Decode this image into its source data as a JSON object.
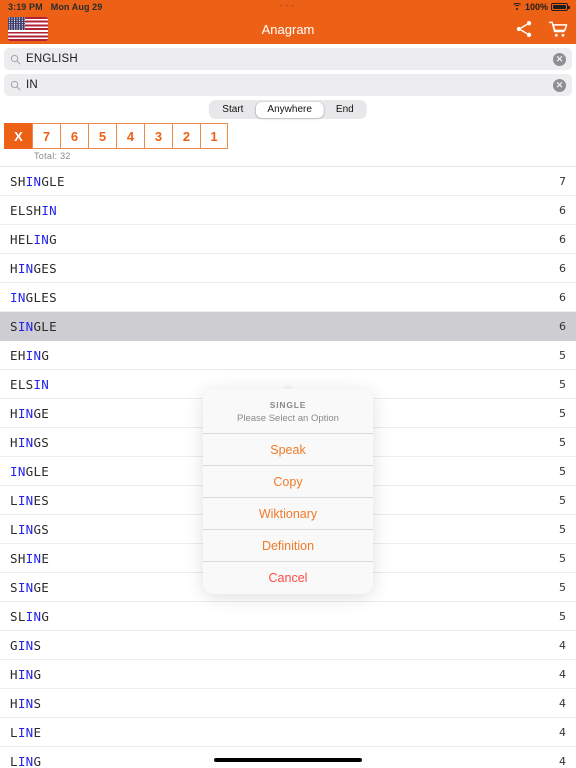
{
  "status_bar": {
    "time": "3:19 PM",
    "date": "Mon Aug 29",
    "center_dots": "•••",
    "battery_percent": "100%",
    "wifi_icon": "wifi-icon",
    "battery_icon": "battery-full-icon"
  },
  "nav_bar": {
    "title": "Anagram",
    "flag_icon": "us-flag-icon",
    "share_icon": "share-icon",
    "cart_icon": "shopping-cart-icon",
    "background_color": "#EC6116"
  },
  "search": {
    "fields": [
      {
        "value": "ENGLISH",
        "placeholder": "Search",
        "icon": "search-icon",
        "clear_icon": "clear-circle-icon"
      },
      {
        "value": "IN",
        "placeholder": "Search",
        "icon": "search-icon",
        "clear_icon": "clear-circle-icon"
      }
    ]
  },
  "match_mode": {
    "options": [
      "Start",
      "Anywhere",
      "End"
    ],
    "selected": "Anywhere"
  },
  "length_filter": {
    "buttons": [
      "X",
      "7",
      "6",
      "5",
      "4",
      "3",
      "2",
      "1"
    ],
    "active": "X",
    "accent_color": "#EC6116"
  },
  "total_label": "Total:",
  "total_value": "32",
  "highlight_term": "IN",
  "highlight_color": "#2222EE",
  "results": [
    {
      "word": "SHINGLE",
      "count": "7",
      "selected": false
    },
    {
      "word": "ELSHIN",
      "count": "6",
      "selected": false
    },
    {
      "word": "HELING",
      "count": "6",
      "selected": false
    },
    {
      "word": "HINGES",
      "count": "6",
      "selected": false
    },
    {
      "word": "INGLES",
      "count": "6",
      "selected": false
    },
    {
      "word": "SINGLE",
      "count": "6",
      "selected": true
    },
    {
      "word": "EHING",
      "count": "5",
      "selected": false
    },
    {
      "word": "ELSIN",
      "count": "5",
      "selected": false
    },
    {
      "word": "HINGE",
      "count": "5",
      "selected": false
    },
    {
      "word": "HINGS",
      "count": "5",
      "selected": false
    },
    {
      "word": "INGLE",
      "count": "5",
      "selected": false
    },
    {
      "word": "LINES",
      "count": "5",
      "selected": false
    },
    {
      "word": "LINGS",
      "count": "5",
      "selected": false
    },
    {
      "word": "SHINE",
      "count": "5",
      "selected": false
    },
    {
      "word": "SINGE",
      "count": "5",
      "selected": false
    },
    {
      "word": "SLING",
      "count": "5",
      "selected": false
    },
    {
      "word": "GINS",
      "count": "4",
      "selected": false
    },
    {
      "word": "HING",
      "count": "4",
      "selected": false
    },
    {
      "word": "HINS",
      "count": "4",
      "selected": false
    },
    {
      "word": "LINE",
      "count": "4",
      "selected": false
    },
    {
      "word": "LING",
      "count": "4",
      "selected": false
    }
  ],
  "popover": {
    "title": "SINGLE",
    "subtitle": "Please Select an Option",
    "options": [
      {
        "label": "Speak",
        "style": "normal"
      },
      {
        "label": "Copy",
        "style": "normal"
      },
      {
        "label": "Wiktionary",
        "style": "normal"
      },
      {
        "label": "Definition",
        "style": "normal"
      },
      {
        "label": "Cancel",
        "style": "cancel"
      }
    ]
  }
}
